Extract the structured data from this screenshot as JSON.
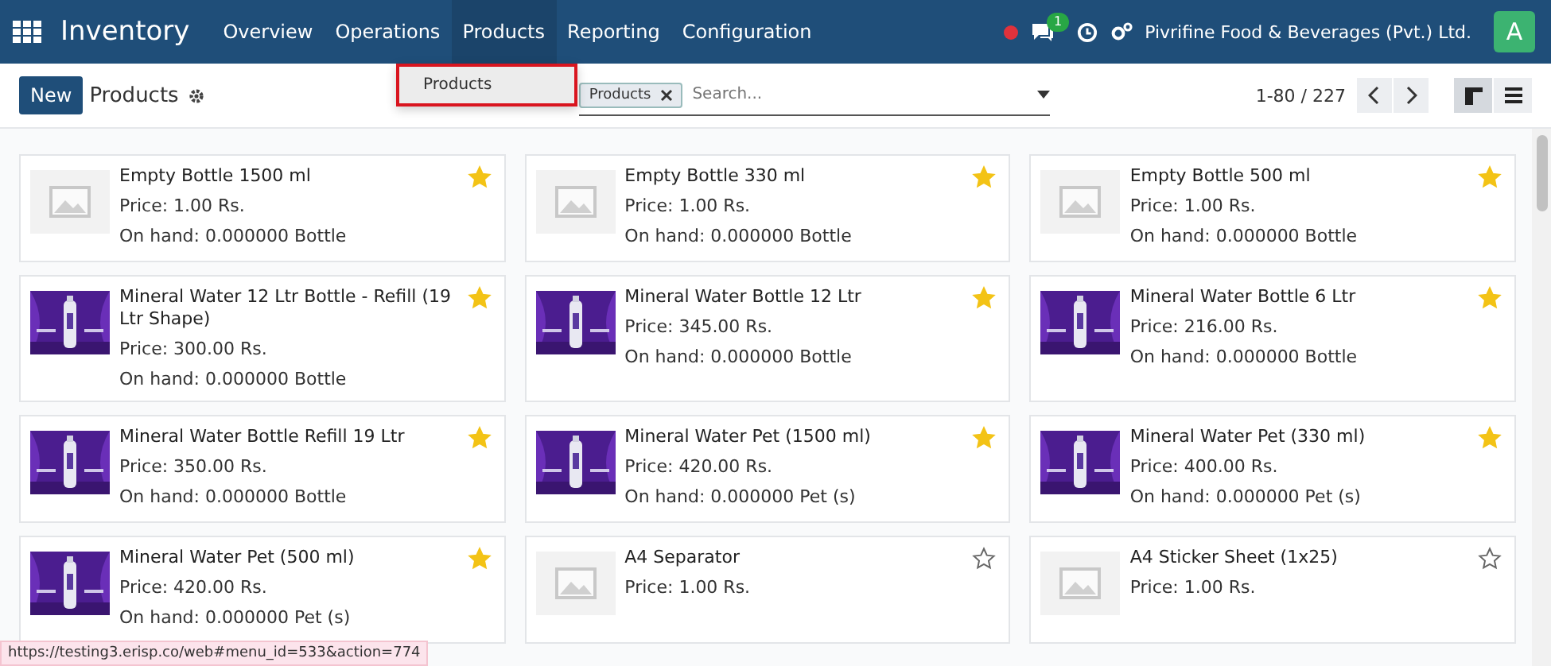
{
  "navbar": {
    "app_name": "Inventory",
    "menu": [
      {
        "label": "Overview",
        "open": false
      },
      {
        "label": "Operations",
        "open": false
      },
      {
        "label": "Products",
        "open": true
      },
      {
        "label": "Reporting",
        "open": false
      },
      {
        "label": "Configuration",
        "open": false
      }
    ],
    "message_count": "1",
    "company": "Pivrifine Food & Beverages (Pvt.) Ltd.",
    "avatar": "A"
  },
  "dropdown": {
    "items": [
      {
        "label": "Products",
        "highlighted": true
      }
    ]
  },
  "control_bar": {
    "new_button": "New",
    "breadcrumb": "Products",
    "facet": "Products",
    "search_placeholder": "Search...",
    "pager": "1-80 / 227",
    "views": [
      {
        "kind": "kanban",
        "selected": true
      },
      {
        "kind": "list",
        "selected": false
      }
    ]
  },
  "products": [
    {
      "name": "Empty Bottle 1500 ml",
      "price": "Price: 1.00 Rs.",
      "on_hand": "On hand: 0.000000 Bottle",
      "favorite": true,
      "kind": "placeholder"
    },
    {
      "name": "Empty Bottle 330 ml",
      "price": "Price: 1.00 Rs.",
      "on_hand": "On hand: 0.000000 Bottle",
      "favorite": true,
      "kind": "placeholder"
    },
    {
      "name": "Empty Bottle 500 ml",
      "price": "Price: 1.00 Rs.",
      "on_hand": "On hand: 0.000000 Bottle",
      "favorite": true,
      "kind": "placeholder"
    },
    {
      "name": "Mineral Water 12 Ltr Bottle - Refill (19 Ltr Shape)",
      "price": "Price: 300.00 Rs.",
      "on_hand": "On hand: 0.000000 Bottle",
      "favorite": true,
      "kind": "picture"
    },
    {
      "name": "Mineral Water Bottle 12 Ltr",
      "price": "Price: 345.00 Rs.",
      "on_hand": "On hand: 0.000000 Bottle",
      "favorite": true,
      "kind": "picture"
    },
    {
      "name": "Mineral Water Bottle 6 Ltr",
      "price": "Price: 216.00 Rs.",
      "on_hand": "On hand: 0.000000 Bottle",
      "favorite": true,
      "kind": "picture"
    },
    {
      "name": "Mineral Water Bottle Refill 19 Ltr",
      "price": "Price: 350.00 Rs.",
      "on_hand": "On hand: 0.000000 Bottle",
      "favorite": true,
      "kind": "picture"
    },
    {
      "name": "Mineral Water Pet (1500 ml)",
      "price": "Price: 420.00 Rs.",
      "on_hand": "On hand: 0.000000 Pet (s)",
      "favorite": true,
      "kind": "picture"
    },
    {
      "name": "Mineral Water Pet (330 ml)",
      "price": "Price: 400.00 Rs.",
      "on_hand": "On hand: 0.000000 Pet (s)",
      "favorite": true,
      "kind": "picture"
    },
    {
      "name": "Mineral Water Pet (500 ml)",
      "price": "Price: 420.00 Rs.",
      "on_hand": "On hand: 0.000000 Pet (s)",
      "favorite": true,
      "kind": "picture"
    },
    {
      "name": "A4 Separator",
      "price": "Price: 1.00 Rs.",
      "favorite": false,
      "kind": "placeholder"
    },
    {
      "name": "A4 Sticker Sheet (1x25)",
      "price": "Price: 1.00 Rs.",
      "favorite": false,
      "kind": "placeholder"
    }
  ],
  "status_url": "https://testing3.erisp.co/web#menu_id=533&action=774"
}
